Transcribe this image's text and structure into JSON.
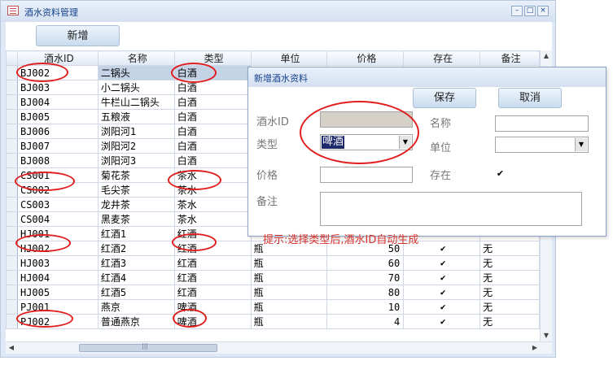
{
  "window": {
    "title": "酒水资料管理",
    "min": "–",
    "max": "□",
    "close": "×"
  },
  "toolbar": {
    "add_label": "新增"
  },
  "grid": {
    "columns": [
      "酒水ID",
      "名称",
      "类型",
      "单位",
      "价格",
      "存在",
      "备注"
    ],
    "rows": [
      [
        "BJ002",
        "二锅头",
        "白酒",
        "",
        "",
        "",
        ""
      ],
      [
        "BJ003",
        "小二锅头",
        "白酒",
        "",
        "",
        "",
        ""
      ],
      [
        "BJ004",
        "牛栏山二锅头",
        "白酒",
        "",
        "",
        "",
        ""
      ],
      [
        "BJ005",
        "五粮液",
        "白酒",
        "",
        "",
        "",
        ""
      ],
      [
        "BJ006",
        "浏阳河1",
        "白酒",
        "",
        "",
        "",
        ""
      ],
      [
        "BJ007",
        "浏阳河2",
        "白酒",
        "",
        "",
        "",
        ""
      ],
      [
        "BJ008",
        "浏阳河3",
        "白酒",
        "",
        "",
        "",
        ""
      ],
      [
        "CS001",
        "菊花茶",
        "茶水",
        "",
        "",
        "",
        ""
      ],
      [
        "CS002",
        "毛尖茶",
        "茶水",
        "",
        "",
        "",
        ""
      ],
      [
        "CS003",
        "龙井茶",
        "茶水",
        "",
        "",
        "",
        ""
      ],
      [
        "CS004",
        "黑麦茶",
        "茶水",
        "",
        "",
        "",
        ""
      ],
      [
        "HJ001",
        "红酒1",
        "红酒",
        "",
        "",
        "",
        ""
      ],
      [
        "HJ002",
        "红酒2",
        "红酒",
        "瓶",
        "50",
        "✔",
        "无"
      ],
      [
        "HJ003",
        "红酒3",
        "红酒",
        "瓶",
        "60",
        "✔",
        "无"
      ],
      [
        "HJ004",
        "红酒4",
        "红酒",
        "瓶",
        "70",
        "✔",
        "无"
      ],
      [
        "HJ005",
        "红酒5",
        "红酒",
        "瓶",
        "80",
        "✔",
        "无"
      ],
      [
        "PJ001",
        "燕京",
        "啤酒",
        "瓶",
        "10",
        "✔",
        "无"
      ],
      [
        "PJ002",
        "普通燕京",
        "啤酒",
        "瓶",
        "4",
        "✔",
        "无"
      ]
    ]
  },
  "dialog": {
    "title": "新增酒水资料",
    "save_label": "保存",
    "cancel_label": "取消",
    "id_label": "酒水ID",
    "name_label": "名称",
    "type_label": "类型",
    "type_value": "啤酒",
    "unit_label": "单位",
    "price_label": "价格",
    "exists_label": "存在",
    "exists_checked": "✔",
    "note_label": "备注",
    "hint": "提示:选择类型后,酒水ID自动生成"
  },
  "scroll": {
    "left": "◀",
    "right": "▶",
    "up": "▲",
    "down": "▼",
    "grip": "|||"
  },
  "colors": {
    "annotation": "#e01e1e",
    "hint": "#d9312b",
    "title_text": "#15428b"
  }
}
